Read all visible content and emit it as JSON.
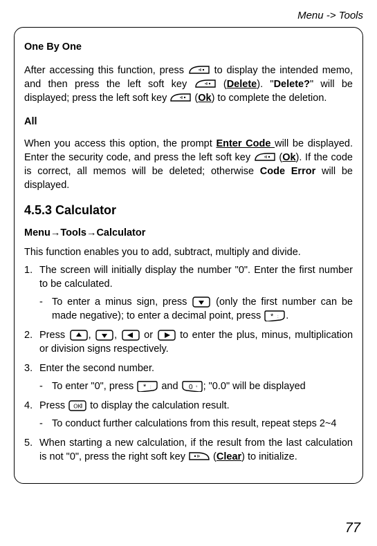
{
  "header": {
    "breadcrumb": "Menu -> Tools"
  },
  "sec1": {
    "head": "One By One",
    "p1a": "After accessing this function, press ",
    "p1b": " to display the intended memo, and then press the left soft key ",
    "p1c": " (",
    "delete": "Delete",
    "p1d": "). \"",
    "deleteq": "Delete?",
    "p1e": "\" will be displayed; press the left soft key ",
    "p1f": " (",
    "ok": "Ok",
    "p1g": ") to complete the deletion."
  },
  "sec2": {
    "head": "All",
    "p1a": "When you access this option, the prompt ",
    "entercode": "Enter Code ",
    "p1b": "will be displayed. Enter the security code, and press the left soft key ",
    "p1c": " (",
    "ok": "Ok",
    "p1d": "). If the code is correct, all memos will be deleted; otherwise ",
    "codeerr": "Code Error",
    "p1e": " will be displayed."
  },
  "calc": {
    "heading": "4.5.3 Calculator",
    "path_a": "Menu",
    "path_b": "Tools",
    "path_c": "Calculator",
    "intro": "This function enables you to add, subtract, multiply and divide.",
    "li1": "The screen will initially display the number \"0\". Enter the first number to be calculated.",
    "li1_sub_a": "To enter a minus sign, press ",
    "li1_sub_b": " (only the first number can be made negative); to enter a decimal point, press ",
    "li2_a": "Press ",
    "li2_b": ", ",
    "li2_c": ", ",
    "li2_d": " or ",
    "li2_e": " to enter the plus, minus, multiplication or division signs respectively.",
    "li3": "Enter the second number.",
    "li3_sub_a": "To enter \"0\", press ",
    "li3_sub_b": " and ",
    "li3_sub_c": "; \"0.0\" will be displayed",
    "li4_a": "Press ",
    "li4_b": " to display the calculation result.",
    "li4_sub": "To conduct further calculations from this result, repeat steps 2~4",
    "li5_a": "When starting a new calculation, if the result from the last calculation is not \"0\", press the right soft key ",
    "li5_b": " (",
    "clear": "Clear",
    "li5_c": ") to initialize."
  },
  "page": "77"
}
